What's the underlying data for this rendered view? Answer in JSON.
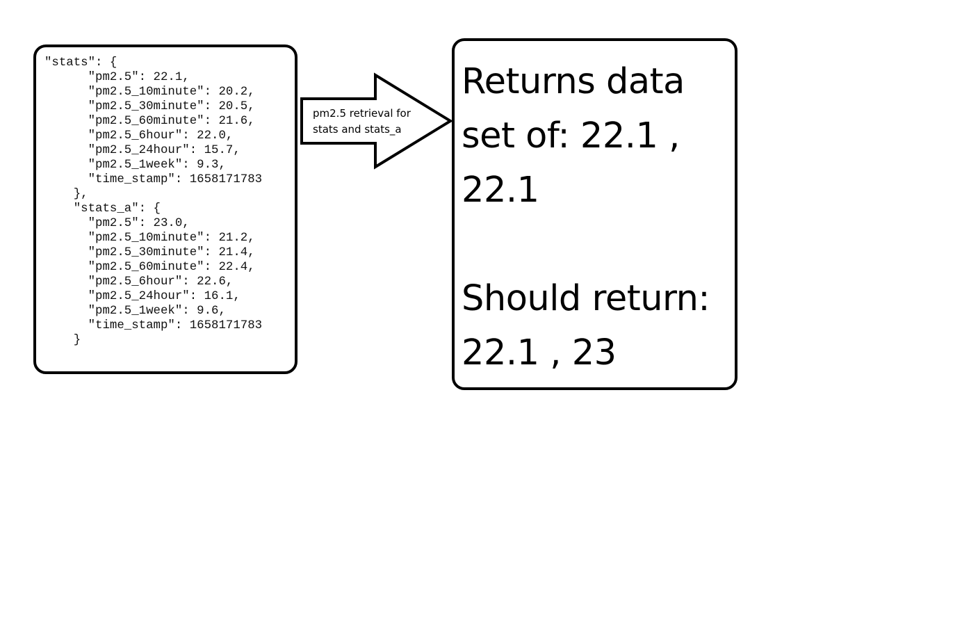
{
  "code_box": {
    "lines": [
      "\"stats\": {",
      "      \"pm2.5\": 22.1,",
      "      \"pm2.5_10minute\": 20.2,",
      "      \"pm2.5_30minute\": 20.5,",
      "      \"pm2.5_60minute\": 21.6,",
      "      \"pm2.5_6hour\": 22.0,",
      "      \"pm2.5_24hour\": 15.7,",
      "      \"pm2.5_1week\": 9.3,",
      "      \"time_stamp\": 1658171783",
      "    },",
      "    \"stats_a\": {",
      "      \"pm2.5\": 23.0,",
      "      \"pm2.5_10minute\": 21.2,",
      "      \"pm2.5_30minute\": 21.4,",
      "      \"pm2.5_60minute\": 22.4,",
      "      \"pm2.5_6hour\": 22.6,",
      "      \"pm2.5_24hour\": 16.1,",
      "      \"pm2.5_1week\": 9.6,",
      "      \"time_stamp\": 1658171783",
      "    }"
    ]
  },
  "arrow": {
    "label_lines": [
      "pm2.5 retrieval for",
      "stats and stats_a"
    ]
  },
  "result_box": {
    "lines": [
      "Returns data",
      "set of: 22.1 ,",
      "22.1",
      "",
      "Should return:",
      "22.1 , 23"
    ]
  },
  "colors": {
    "stroke": "#000000",
    "background": "#ffffff"
  }
}
